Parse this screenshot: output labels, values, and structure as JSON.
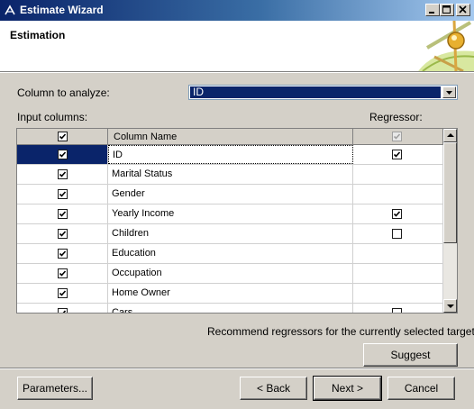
{
  "window": {
    "title": "Estimate Wizard",
    "icon": "wizard-icon",
    "controls": [
      "minimize-icon",
      "maximize-icon",
      "close-icon"
    ]
  },
  "header": {
    "title": "Estimation",
    "logo_icon": "network-node-icon"
  },
  "column_to_analyze": {
    "label": "Column to analyze:",
    "value": "ID"
  },
  "input_columns_label": "Input columns:",
  "regressor_label": "Regressor:",
  "grid": {
    "headers": {
      "check": true,
      "column_name": "Column Name",
      "regressor": true
    },
    "rows": [
      {
        "input": true,
        "name": "ID",
        "regressor": true,
        "regressor_visible": true,
        "selected": true
      },
      {
        "input": true,
        "name": "Marital Status",
        "regressor": false,
        "regressor_visible": false,
        "selected": false
      },
      {
        "input": true,
        "name": "Gender",
        "regressor": false,
        "regressor_visible": false,
        "selected": false
      },
      {
        "input": true,
        "name": "Yearly Income",
        "regressor": true,
        "regressor_visible": true,
        "selected": false
      },
      {
        "input": true,
        "name": "Children",
        "regressor": false,
        "regressor_visible": true,
        "selected": false
      },
      {
        "input": true,
        "name": "Education",
        "regressor": false,
        "regressor_visible": false,
        "selected": false
      },
      {
        "input": true,
        "name": "Occupation",
        "regressor": false,
        "regressor_visible": false,
        "selected": false
      },
      {
        "input": true,
        "name": "Home Owner",
        "regressor": false,
        "regressor_visible": false,
        "selected": false
      },
      {
        "input": true,
        "name": "Cars",
        "regressor": false,
        "regressor_visible": true,
        "selected": false
      }
    ],
    "scroll_position": 0
  },
  "recommend_text": "Recommend regressors for the currently selected target:",
  "buttons": {
    "suggest": "Suggest",
    "parameters": "Parameters...",
    "back": "< Back",
    "next": "Next >",
    "cancel": "Cancel"
  },
  "colors": {
    "title_bar_start": "#0a246a",
    "title_bar_end": "#a6caf0",
    "selection": "#0a246a",
    "face": "#d4d0c8"
  }
}
